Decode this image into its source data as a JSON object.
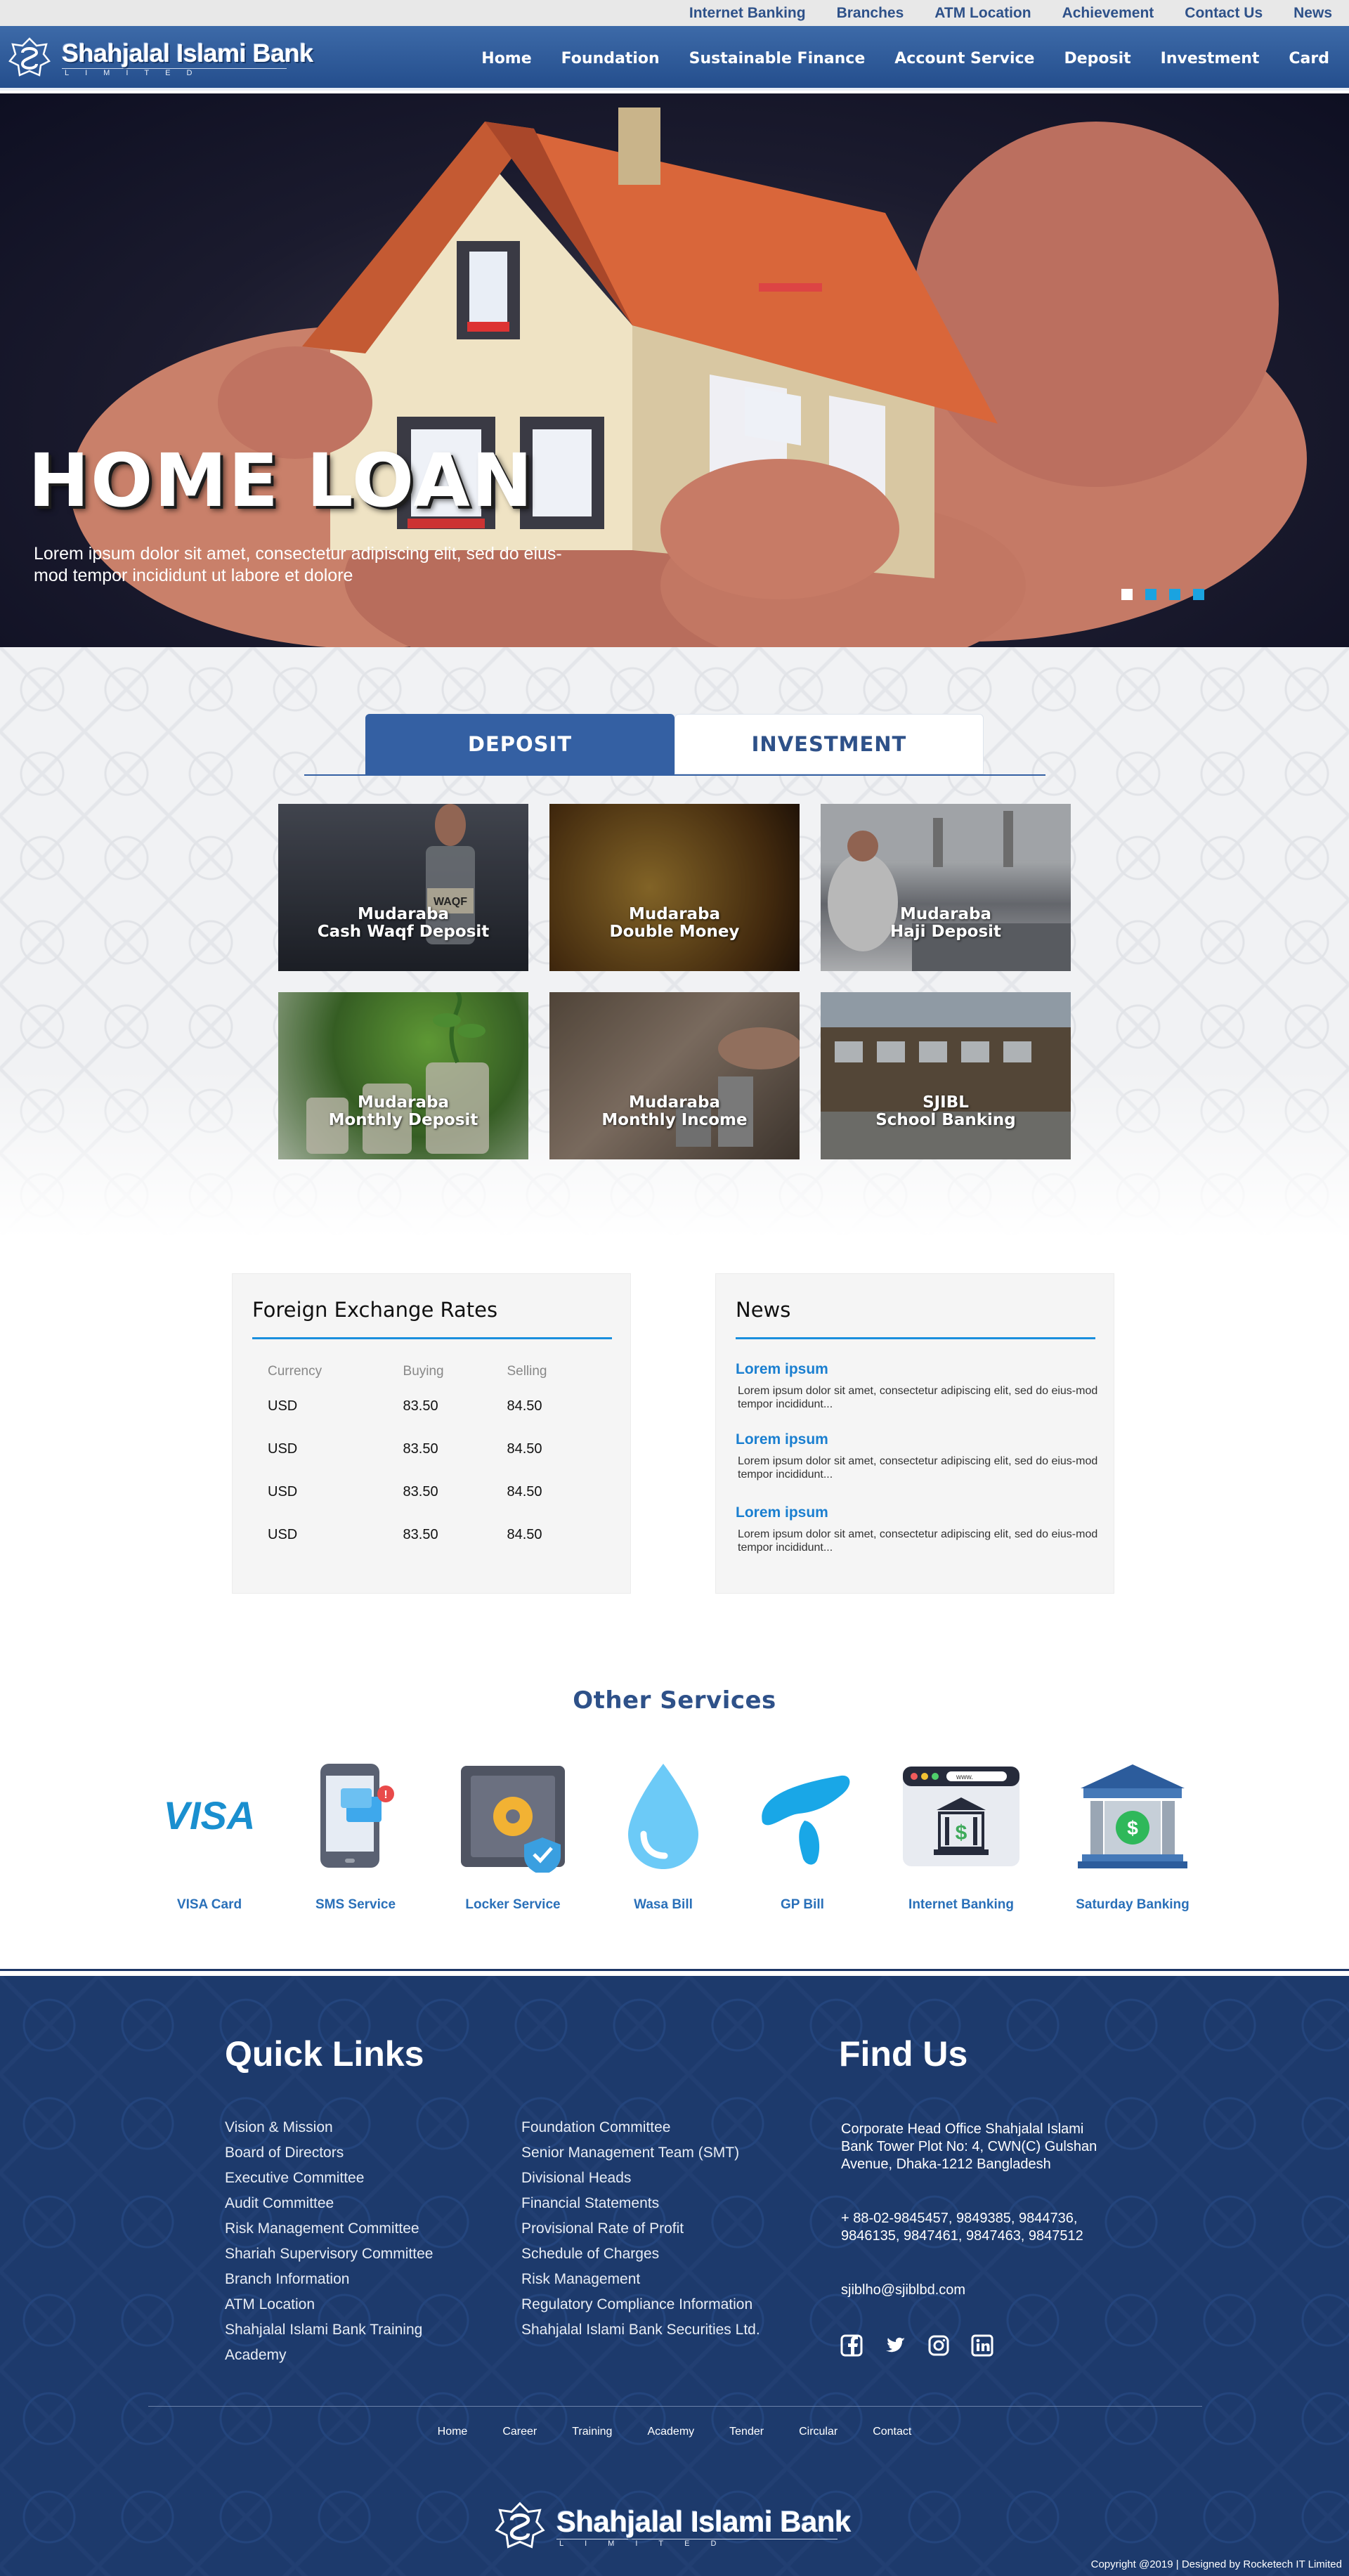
{
  "topbar": {
    "links": [
      "Internet Banking",
      "Branches",
      "ATM Location",
      "Achievement",
      "Contact Us",
      "News"
    ]
  },
  "brand": {
    "name": "Shahjalal Islami Bank",
    "sub": "LIMITED"
  },
  "mainnav": [
    "Home",
    "Foundation",
    "Sustainable Finance",
    "Account Service",
    "Deposit",
    "Investment",
    "Card"
  ],
  "hero": {
    "title": "HOME LOAN",
    "text": "Lorem ipsum dolor sit amet, consectetur adipiscing elit, sed do eius-mod tempor incididunt ut labore et dolore",
    "active_slide": 1,
    "slide_count": 4
  },
  "tabs": {
    "deposit": "DEPOSIT",
    "investment": "INVESTMENT",
    "active": "DEPOSIT"
  },
  "cards": [
    {
      "line1": "Mudaraba",
      "line2": "Cash Waqf Deposit"
    },
    {
      "line1": "Mudaraba",
      "line2": "Double Money"
    },
    {
      "line1": "Mudaraba",
      "line2": "Haji Deposit"
    },
    {
      "line1": "Mudaraba",
      "line2": "Monthly Deposit"
    },
    {
      "line1": "Mudaraba",
      "line2": "Monthly Income"
    },
    {
      "line1": "SJIBL",
      "line2": "School Banking"
    }
  ],
  "card_art_text": "WAQF",
  "rates": {
    "title": "Foreign Exchange Rates",
    "headers": [
      "Currency",
      "Buying",
      "Selling"
    ],
    "rows": [
      [
        "USD",
        "83.50",
        "84.50"
      ],
      [
        "USD",
        "83.50",
        "84.50"
      ],
      [
        "USD",
        "83.50",
        "84.50"
      ],
      [
        "USD",
        "83.50",
        "84.50"
      ]
    ]
  },
  "news": {
    "title": "News",
    "items": [
      {
        "title": "Lorem ipsum",
        "body": "Lorem ipsum dolor sit amet, consectetur adipiscing elit, sed do eius-mod tempor incididunt..."
      },
      {
        "title": "Lorem ipsum",
        "body": "Lorem ipsum dolor sit amet, consectetur adipiscing elit, sed do eius-mod tempor incididunt..."
      },
      {
        "title": "Lorem ipsum",
        "body": "Lorem ipsum dolor sit amet, consectetur adipiscing elit, sed do eius-mod tempor incididunt..."
      }
    ]
  },
  "services": {
    "title": "Other Services",
    "items": [
      {
        "name": "VISA Card",
        "icon": "visa-icon"
      },
      {
        "name": "SMS Service",
        "icon": "phone-sms-icon"
      },
      {
        "name": "Locker Service",
        "icon": "safe-locker-icon"
      },
      {
        "name": "Wasa Bill",
        "icon": "water-drop-icon"
      },
      {
        "name": "GP Bill",
        "icon": "gp-telenor-icon"
      },
      {
        "name": "Internet Banking",
        "icon": "browser-bank-icon"
      },
      {
        "name": "Saturday Banking",
        "icon": "bank-building-icon"
      }
    ],
    "visa_text": "VISA",
    "url_text": "www."
  },
  "footer": {
    "quick_links_title": "Quick Links",
    "links_col1": [
      "Vision & Mission",
      "Board of Directors",
      "Executive Committee",
      "Audit Committee",
      "Risk Management Committee",
      "Shariah Supervisory Committee",
      "Branch Information",
      "ATM Location",
      "Shahjalal Islami Bank Training",
      "Academy"
    ],
    "links_col2": [
      "Foundation Committee",
      "Senior Management Team (SMT)",
      "Divisional Heads",
      "Financial Statements",
      "Provisional Rate of Profit",
      "Schedule of Charges",
      "Risk Management",
      "Regulatory Compliance Information",
      "Shahjalal Islami Bank Securities Ltd."
    ],
    "find_title": "Find Us",
    "address": "Corporate Head Office Shahjalal Islami Bank Tower Plot No: 4, CWN(C) Gulshan Avenue, Dhaka-1212 Bangladesh",
    "phones": "+ 88-02-9845457, 9849385, 9844736, 9846135, 9847461, 9847463, 9847512",
    "email": "sjiblho@sjiblbd.com",
    "social": [
      "facebook-icon",
      "twitter-icon",
      "instagram-icon",
      "linkedin-icon"
    ],
    "bottom_nav": [
      "Home",
      "Career",
      "Training",
      "Academy",
      "Tender",
      "Circular",
      "Contact"
    ],
    "copyright": "Copyright @2019 | Designed by Rocketech IT Limited"
  },
  "colors": {
    "brand_blue": "#2e5189",
    "accent_cyan": "#1aa3e0",
    "footer_navy": "#1d3a6c",
    "link_blue": "#1a7fd0"
  }
}
